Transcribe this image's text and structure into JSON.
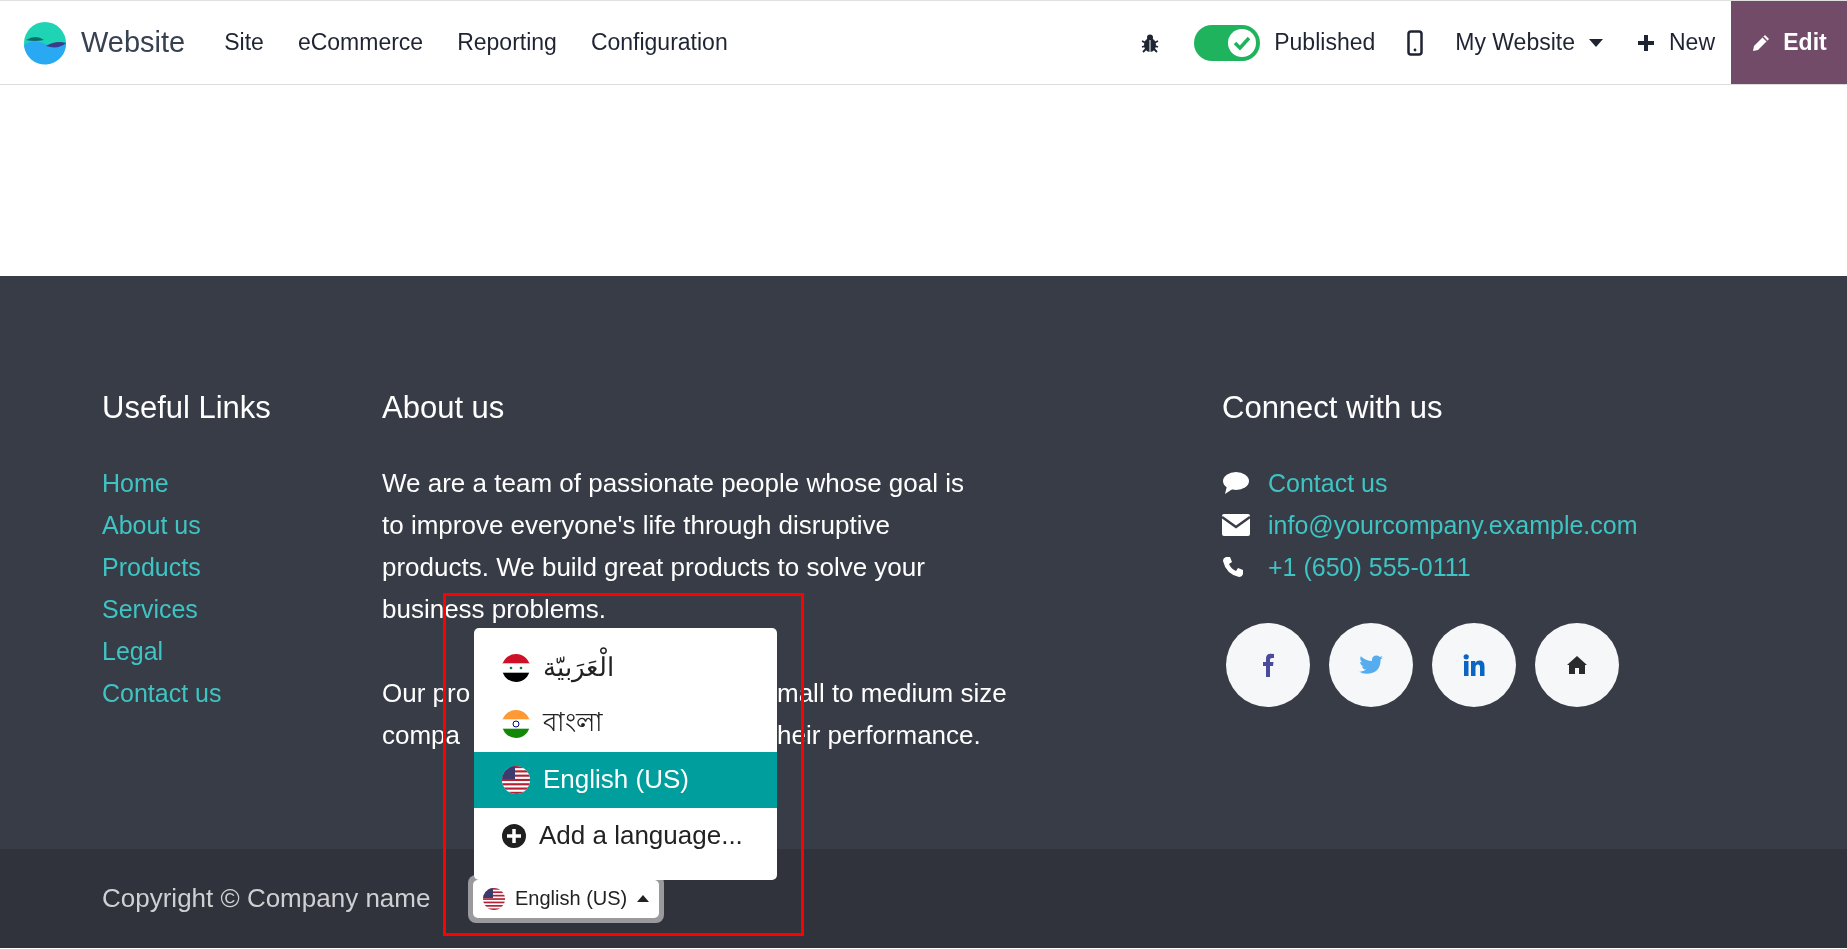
{
  "navbar": {
    "app_name": "Website",
    "menu": [
      "Site",
      "eCommerce",
      "Reporting",
      "Configuration"
    ],
    "published": {
      "label": "Published",
      "on": true
    },
    "website_selector": "My Website",
    "new_button": "New",
    "edit_button": "Edit"
  },
  "footer": {
    "useful_links": {
      "title": "Useful Links",
      "links": [
        "Home",
        "About us",
        "Products",
        "Services",
        "Legal",
        "Contact us"
      ]
    },
    "about": {
      "title": "About us",
      "paragraph": "We are a team of passionate people whose goal is to improve everyone's life through disruptive products. We build great products to solve your business problems.",
      "covered_lines": [
        {
          "left": "Our pro",
          "right": "mall to medium size"
        },
        {
          "left": "compa",
          "right": "heir performance."
        }
      ]
    },
    "connect": {
      "title": "Connect with us",
      "contacts": [
        {
          "kind": "chat",
          "text": "Contact us"
        },
        {
          "kind": "mail",
          "text": "info@yourcompany.example.com"
        },
        {
          "kind": "phone",
          "text": "+1 (650) 555-0111"
        }
      ],
      "social_links": [
        {
          "kind": "facebook"
        },
        {
          "kind": "twitter"
        },
        {
          "kind": "linkedin"
        },
        {
          "kind": "home"
        }
      ]
    }
  },
  "bottom_bar": {
    "copyright": "Copyright © Company name",
    "language_button": {
      "label": "English (US)",
      "kind": "us"
    },
    "language_menu": {
      "languages": [
        {
          "label": "الْعَرَبيّة",
          "kind": "sy",
          "selected": false
        },
        {
          "label": "বাংলা",
          "kind": "in",
          "selected": false
        },
        {
          "label": "English (US)",
          "kind": "us",
          "selected": true
        }
      ],
      "add_language": "Add a language..."
    }
  }
}
